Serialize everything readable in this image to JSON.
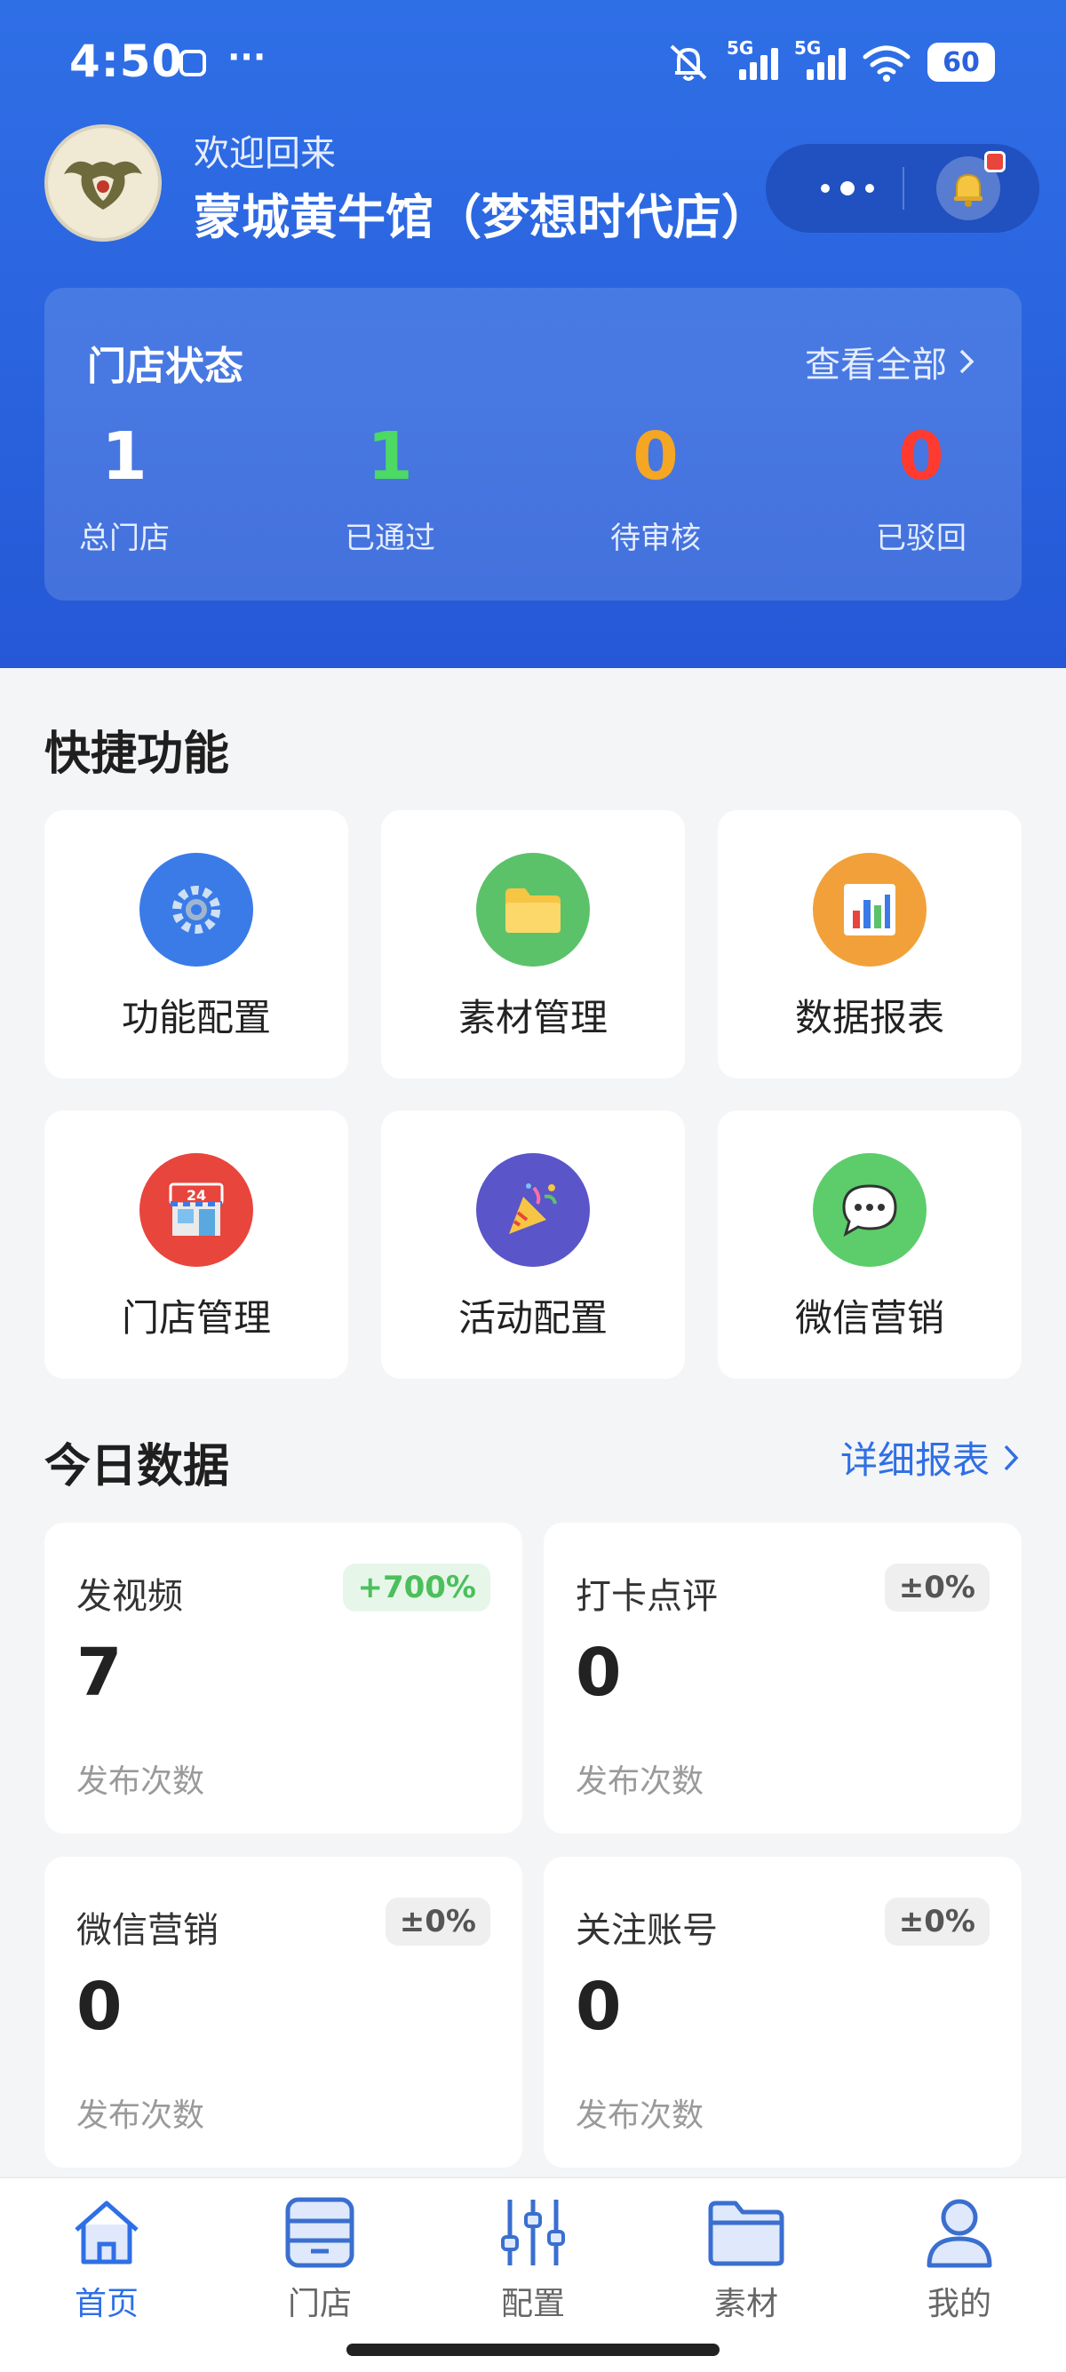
{
  "status_bar": {
    "time": "4:50",
    "dots": "···",
    "battery": "60",
    "network_labels": [
      "5G",
      "5G"
    ]
  },
  "header": {
    "welcome": "欢迎回来",
    "store_name": "蒙城黄牛馆（梦想时代店）"
  },
  "store_status": {
    "title": "门店状态",
    "view_all": "查看全部",
    "stats": [
      {
        "value": "1",
        "label": "总门店",
        "color": "#ffffff"
      },
      {
        "value": "1",
        "label": "已通过",
        "color": "#4cd964"
      },
      {
        "value": "0",
        "label": "待审核",
        "color": "#f5a623"
      },
      {
        "value": "0",
        "label": "已驳回",
        "color": "#ff3b30"
      }
    ]
  },
  "quick": {
    "title": "快捷功能",
    "items": [
      {
        "label": "功能配置",
        "icon": "gear-icon",
        "color": "#3a7be8"
      },
      {
        "label": "素材管理",
        "icon": "folder-icon",
        "color": "#5cc26a"
      },
      {
        "label": "数据报表",
        "icon": "chart-icon",
        "color": "#f2a13a"
      },
      {
        "label": "门店管理",
        "icon": "store-icon",
        "color": "#e8453c"
      },
      {
        "label": "活动配置",
        "icon": "party-icon",
        "color": "#5a55c8"
      },
      {
        "label": "微信营销",
        "icon": "chat-bubble-icon",
        "color": "#5ccd6a"
      }
    ]
  },
  "today": {
    "title": "今日数据",
    "detail_link": "详细报表",
    "cards": [
      {
        "label": "发视频",
        "change": "+700%",
        "value": "7",
        "sub": "发布次数"
      },
      {
        "label": "打卡点评",
        "change": "±0%",
        "value": "0",
        "sub": "发布次数"
      },
      {
        "label": "微信营销",
        "change": "±0%",
        "value": "0",
        "sub": "发布次数"
      },
      {
        "label": "关注账号",
        "change": "±0%",
        "value": "0",
        "sub": "发布次数"
      }
    ]
  },
  "nav": {
    "items": [
      {
        "label": "首页",
        "icon": "home-icon"
      },
      {
        "label": "门店",
        "icon": "store-box-icon"
      },
      {
        "label": "配置",
        "icon": "sliders-icon"
      },
      {
        "label": "素材",
        "icon": "folder-icon"
      },
      {
        "label": "我的",
        "icon": "user-icon"
      }
    ],
    "active_index": 0
  },
  "colors": {
    "primary": "#2f6fe6",
    "header_bg": "#2a63de",
    "page_bg": "#f4f5f7"
  }
}
